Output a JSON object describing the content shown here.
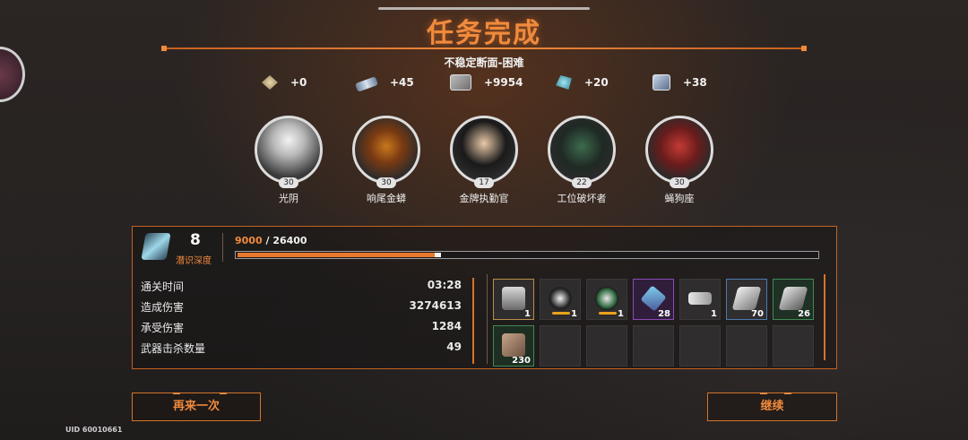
{
  "title": "任务完成",
  "subtitle": "不稳定断面-困难",
  "rewards": [
    {
      "icon": "gem-icon",
      "value": "+0"
    },
    {
      "icon": "weapon-part-icon",
      "value": "+45"
    },
    {
      "icon": "currency-icon",
      "value": "+9954"
    },
    {
      "icon": "crystal-icon",
      "value": "+20"
    },
    {
      "icon": "chip-icon",
      "value": "+38"
    }
  ],
  "characters": [
    {
      "level": "30",
      "name": "光阴"
    },
    {
      "level": "30",
      "name": "响尾金蟒"
    },
    {
      "level": "17",
      "name": "金牌执勤官"
    },
    {
      "level": "22",
      "name": "工位破坏者"
    },
    {
      "level": "30",
      "name": "蝇狗座"
    }
  ],
  "depth": {
    "value": "8",
    "label": "潜识深度"
  },
  "progress": {
    "current": "9000",
    "total": "/ 26400",
    "fraction": 0.34
  },
  "stats": [
    {
      "label": "通关时间",
      "value": "03:28"
    },
    {
      "label": "造成伤害",
      "value": "3274613"
    },
    {
      "label": "承受伤害",
      "value": "1284"
    },
    {
      "label": "武器击杀数量",
      "value": "49"
    }
  ],
  "items": [
    {
      "icon": "supply-box-icon",
      "count": "1",
      "rarity": "gold"
    },
    {
      "icon": "panda-badge-icon",
      "count": "1",
      "rarity": "normal"
    },
    {
      "icon": "green-badge-icon",
      "count": "1",
      "rarity": "normal"
    },
    {
      "icon": "probe-icon",
      "count": "28",
      "rarity": "purple"
    },
    {
      "icon": "pistol-icon",
      "count": "1",
      "rarity": "normal"
    },
    {
      "icon": "metal-plate-icon",
      "count": "70",
      "rarity": "blue"
    },
    {
      "icon": "alloy-plate-icon",
      "count": "26",
      "rarity": "green"
    },
    {
      "icon": "scrap-icon",
      "count": "230",
      "rarity": "green"
    }
  ],
  "buttons": {
    "retry": "再来一次",
    "continue": "继续"
  },
  "uid": "UID 60010661",
  "colors": {
    "accent": "#f08a3c",
    "border": "#c4621f"
  }
}
